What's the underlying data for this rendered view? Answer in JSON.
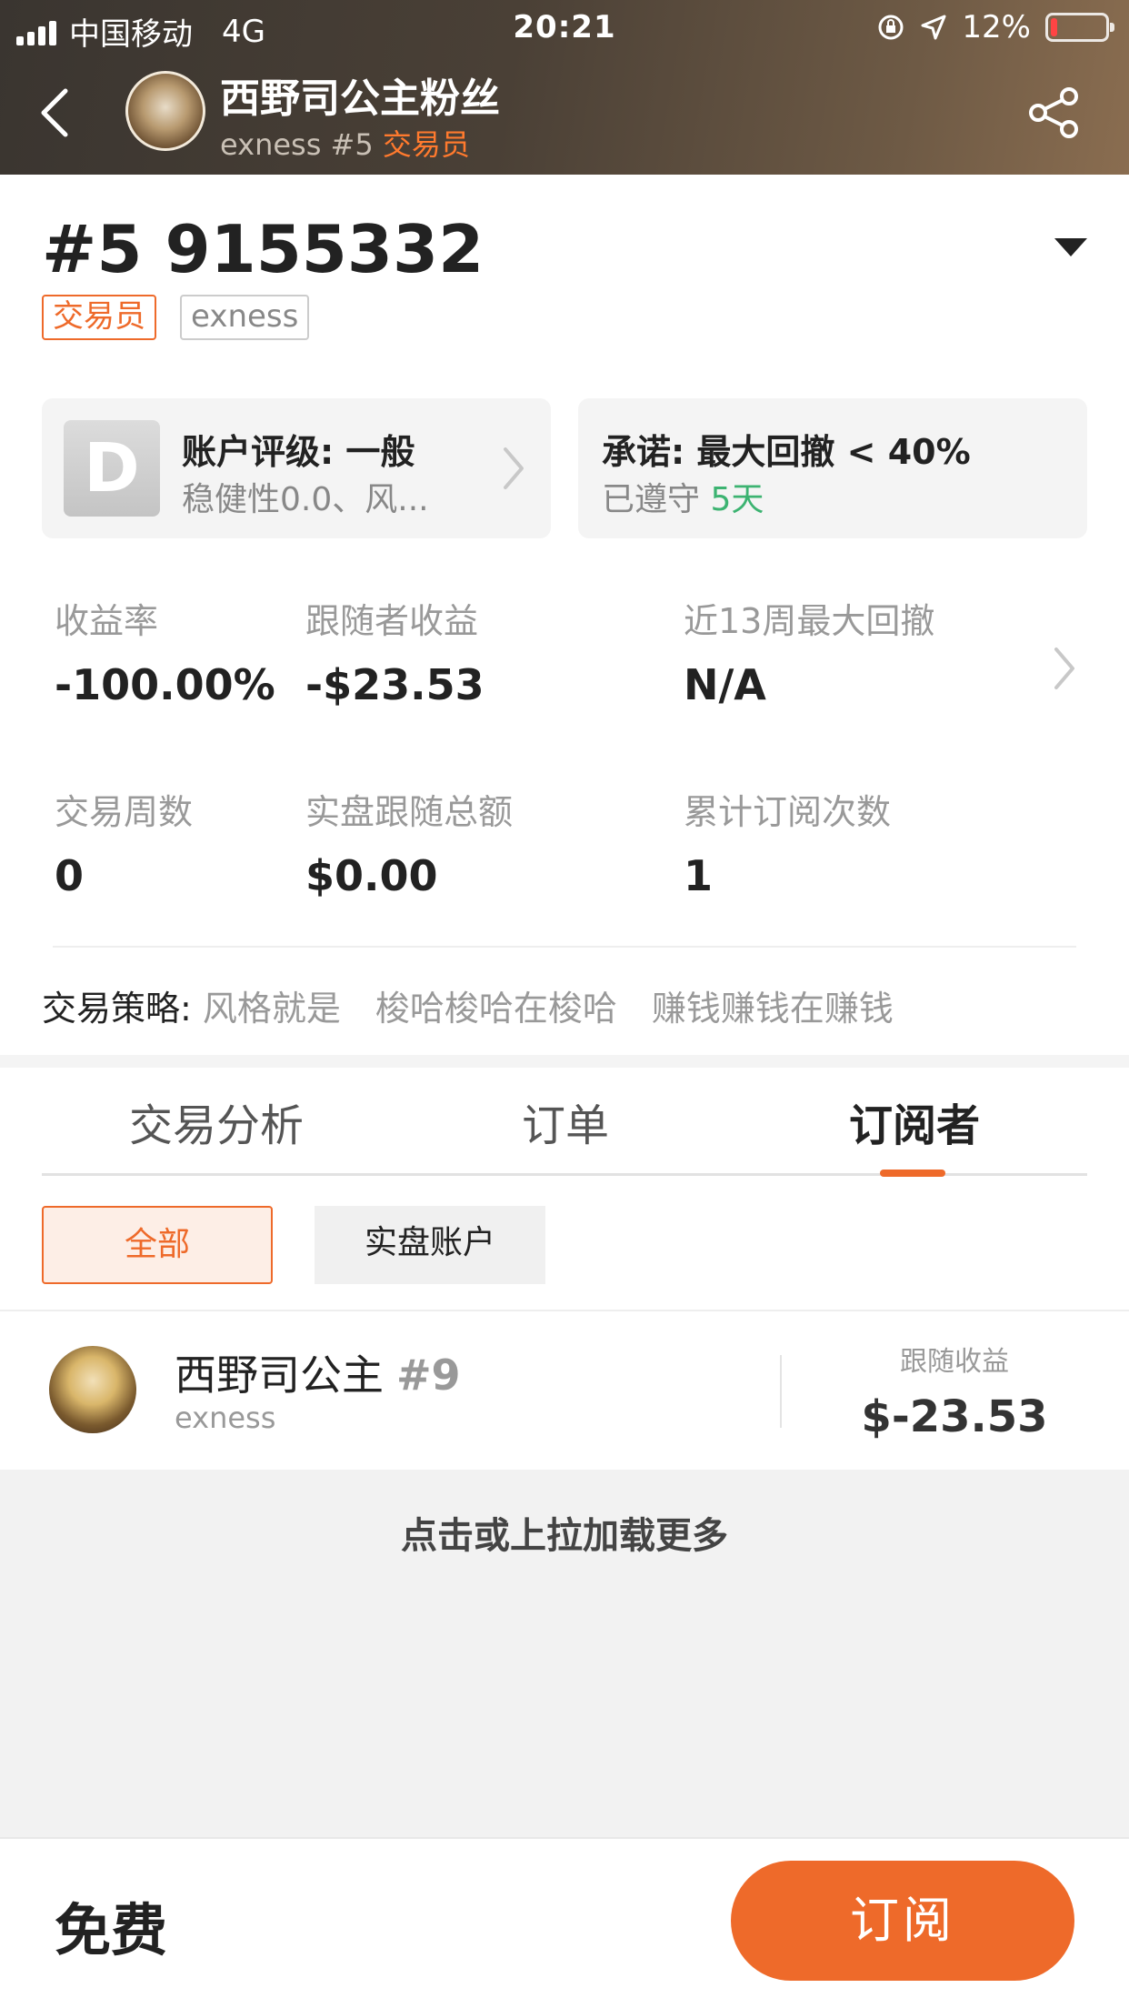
{
  "status_bar": {
    "carrier": "中国移动",
    "network": "4G",
    "time": "20:21",
    "battery_percent": "12%",
    "battery_level": 0.12
  },
  "header": {
    "name": "西野司公主粉丝",
    "broker": "exness",
    "rank": "#5",
    "role": "交易员"
  },
  "account": {
    "title": "#5 9155332",
    "tags": [
      "交易员",
      "exness"
    ]
  },
  "rating_card": {
    "grade": "D",
    "title": "账户评级: 一般",
    "subtitle": "稳健性0.0、风..."
  },
  "commitment_card": {
    "title": "承诺: 最大回撤 < 40%",
    "kept_label": "已遵守",
    "kept_days": "5天"
  },
  "stats": [
    {
      "label": "收益率",
      "value": "-100.00%"
    },
    {
      "label": "跟随者收益",
      "value": "-$23.53"
    },
    {
      "label": "近13周最大回撤",
      "value": "N/A"
    },
    {
      "label": "交易周数",
      "value": "0"
    },
    {
      "label": "实盘跟随总额",
      "value": "$0.00"
    },
    {
      "label": "累计订阅次数",
      "value": "1"
    }
  ],
  "strategy": {
    "label": "交易策略:",
    "text": "风格就是　梭哈梭哈在梭哈　赚钱赚钱在赚钱"
  },
  "tabs": [
    {
      "label": "交易分析",
      "active": false
    },
    {
      "label": "订单",
      "active": false
    },
    {
      "label": "订阅者",
      "active": true
    }
  ],
  "filters": [
    {
      "label": "全部",
      "active": true
    },
    {
      "label": "实盘账户",
      "active": false
    }
  ],
  "subscribers": [
    {
      "name": "西野司公主",
      "rank": "#9",
      "broker": "exness",
      "profit_label": "跟随收益",
      "profit": "$-23.53"
    }
  ],
  "load_more": "点击或上拉加载更多",
  "bottom_bar": {
    "price": "免费",
    "subscribe_label": "订阅"
  },
  "colors": {
    "accent": "#ee6a2a",
    "positive": "#3cb371"
  }
}
